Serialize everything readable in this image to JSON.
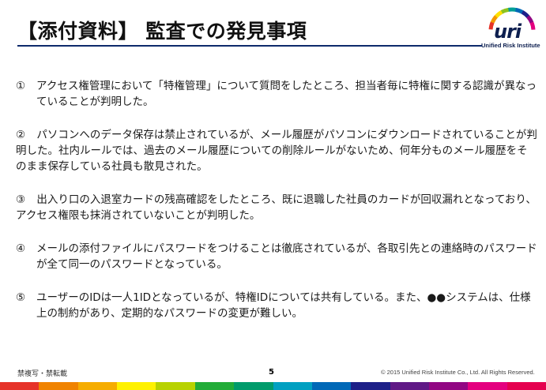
{
  "header": {
    "title": "【添付資料】 監査での発見事項"
  },
  "logo": {
    "word": "uri",
    "subtitle": "Unified Risk Institute",
    "ring_colors": [
      "#e63329",
      "#f39800",
      "#ffe100",
      "#8fc31f",
      "#009e96",
      "#0068b7",
      "#1d2088",
      "#920783",
      "#e4007f"
    ]
  },
  "findings": [
    {
      "num": "①",
      "text": "アクセス権管理において「特権管理」について質問をしたところ、担当者毎に特権に関する認識が異なっていることが判明した。"
    },
    {
      "num": "②",
      "text": "パソコンへのデータ保存は禁止されているが、メール履歴がパソコンにダウンロードされていることが判明した。社内ルールでは、過去のメール履歴についての削除ルールがないため、何年分ものメール履歴をそのまま保存している社員も散見された。"
    },
    {
      "num": "③",
      "text": "出入り口の入退室カードの残高確認をしたところ、既に退職した社員のカードが回収漏れとなっており、アクセス権限も抹消されていないことが判明した。"
    },
    {
      "num": "④",
      "text": "メールの添付ファイルにパスワードをつけることは徹底されているが、各取引先との連絡時のパスワードが全て同一のパスワードとなっている。"
    },
    {
      "num": "⑤",
      "text": "ユーザーのIDは一人1IDとなっているが、特権IDについては共有している。また、●●システムは、仕様上の制約があり、定期的なパスワードの変更が難しい。"
    }
  ],
  "footer": {
    "left": "禁複写・禁転載",
    "page": "5",
    "copyright": "© 2015 Unified Risk Institute Co., Ltd. All Rights Reserved."
  },
  "color_bar": [
    "#e63329",
    "#f08300",
    "#f6ad00",
    "#fff100",
    "#b8d200",
    "#22ac38",
    "#009b6b",
    "#00a0c1",
    "#0068b7",
    "#1d2088",
    "#601986",
    "#920783",
    "#e4007f",
    "#e5004f"
  ]
}
